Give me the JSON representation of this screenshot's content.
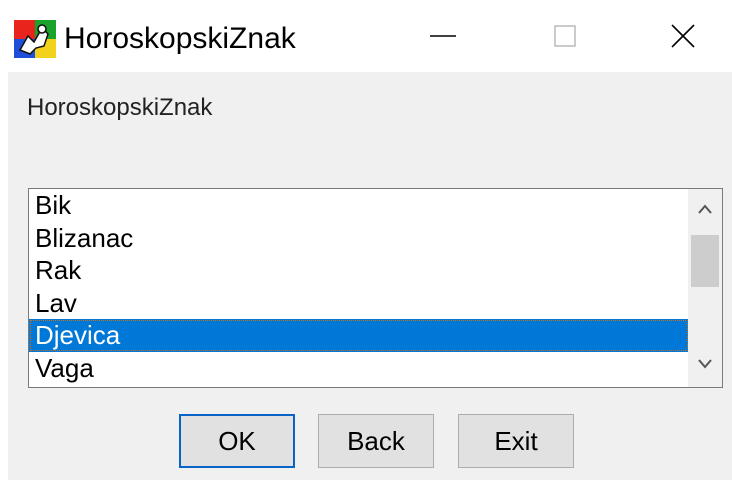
{
  "window": {
    "title": "HoroskopskiZnak",
    "app_icon": "app-icon"
  },
  "dialog": {
    "caption": "HoroskopskiZnak"
  },
  "listbox": {
    "items": [
      "Bik",
      "Blizanac",
      "Rak",
      "Lav",
      "Djevica",
      "Vaga"
    ],
    "selected": "Djevica",
    "scroll_position": 0.3
  },
  "buttons": {
    "ok_label": "OK",
    "back_label": "Back",
    "exit_label": "Exit"
  },
  "colors": {
    "selection": "#0078d7",
    "client_bg": "#f0f0f0",
    "button_face": "#e1e1e1",
    "default_border": "#0a64c8"
  }
}
